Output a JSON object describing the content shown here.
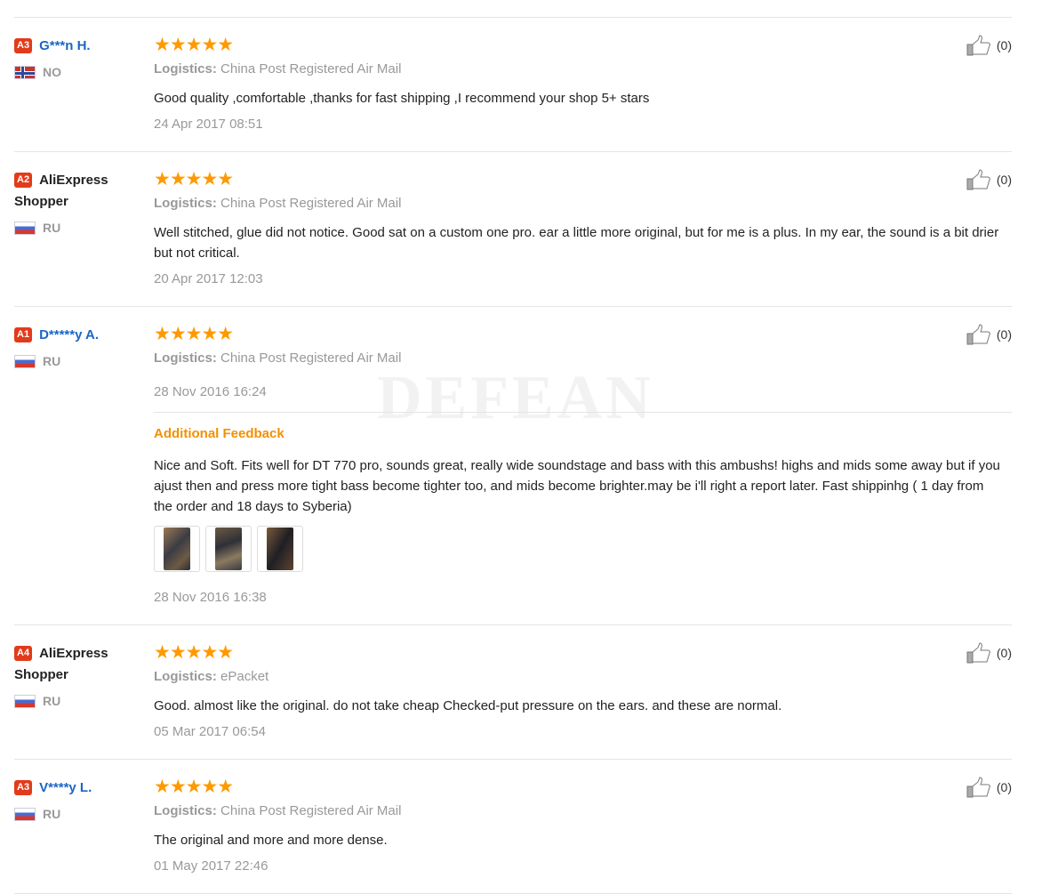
{
  "helpful_prefix": "(",
  "reviews": [
    {
      "level": "A3",
      "name": "G***n H.",
      "name_style": "link",
      "country": "NO",
      "flag": "no",
      "stars": "★★★★★",
      "logistics_label": "Logistics:",
      "logistics": "China Post Registered Air Mail",
      "text": "Good quality ,comfortable ,thanks for fast shipping ,I recommend your shop 5+ stars",
      "date": "24 Apr 2017 08:51",
      "helpful": "(0)"
    },
    {
      "level": "A2",
      "name": "AliExpress Shopper",
      "name_style": "plain",
      "country": "RU",
      "flag": "ru",
      "stars": "★★★★★",
      "logistics_label": "Logistics:",
      "logistics": "China Post Registered Air Mail",
      "text": "Well stitched, glue did not notice. Good sat on a custom one pro. ear a little more original, but for me is a plus. In my ear, the sound is a bit drier but not critical.",
      "date": "20 Apr 2017 12:03",
      "helpful": "(0)"
    },
    {
      "level": "A1",
      "name": "D*****y A.",
      "name_style": "link",
      "country": "RU",
      "flag": "ru",
      "stars": "★★★★★",
      "logistics_label": "Logistics:",
      "logistics": "China Post Registered Air Mail",
      "text": "",
      "date": "28 Nov 2016 16:24",
      "helpful": "(0)",
      "additional": {
        "title": "Additional Feedback",
        "text": "Nice and Soft. Fits well for DT 770 pro, sounds great, really wide soundstage and bass with this ambushs! highs and mids some away but if you ajust then and press more tight bass become tighter too, and mids become brighter.may be i'll right a report later. Fast shippinhg ( 1 day from the order and 18 days to Syberia)",
        "photo_count": 3,
        "date": "28 Nov 2016 16:38"
      }
    },
    {
      "level": "A4",
      "name": "AliExpress Shopper",
      "name_style": "plain",
      "country": "RU",
      "flag": "ru",
      "stars": "★★★★★",
      "logistics_label": "Logistics:",
      "logistics": "ePacket",
      "text": "Good. almost like the original. do not take cheap Checked-put pressure on the ears. and these are normal.",
      "date": "05 Mar 2017 06:54",
      "helpful": "(0)"
    },
    {
      "level": "A3",
      "name": "V****y L.",
      "name_style": "link",
      "country": "RU",
      "flag": "ru",
      "stars": "★★★★★",
      "logistics_label": "Logistics:",
      "logistics": "China Post Registered Air Mail",
      "text": "The original and more and more dense.",
      "date": "01 May 2017 22:46",
      "helpful": "(0)"
    }
  ],
  "watermark": "DEFEAN",
  "colors": {
    "level_badge": "#e23b1b",
    "star": "#ff9900",
    "link": "#1a66c6",
    "additional_title": "#f39000"
  },
  "icons": {
    "helpful": "thumbs-up-icon",
    "rating": "star-icon"
  }
}
